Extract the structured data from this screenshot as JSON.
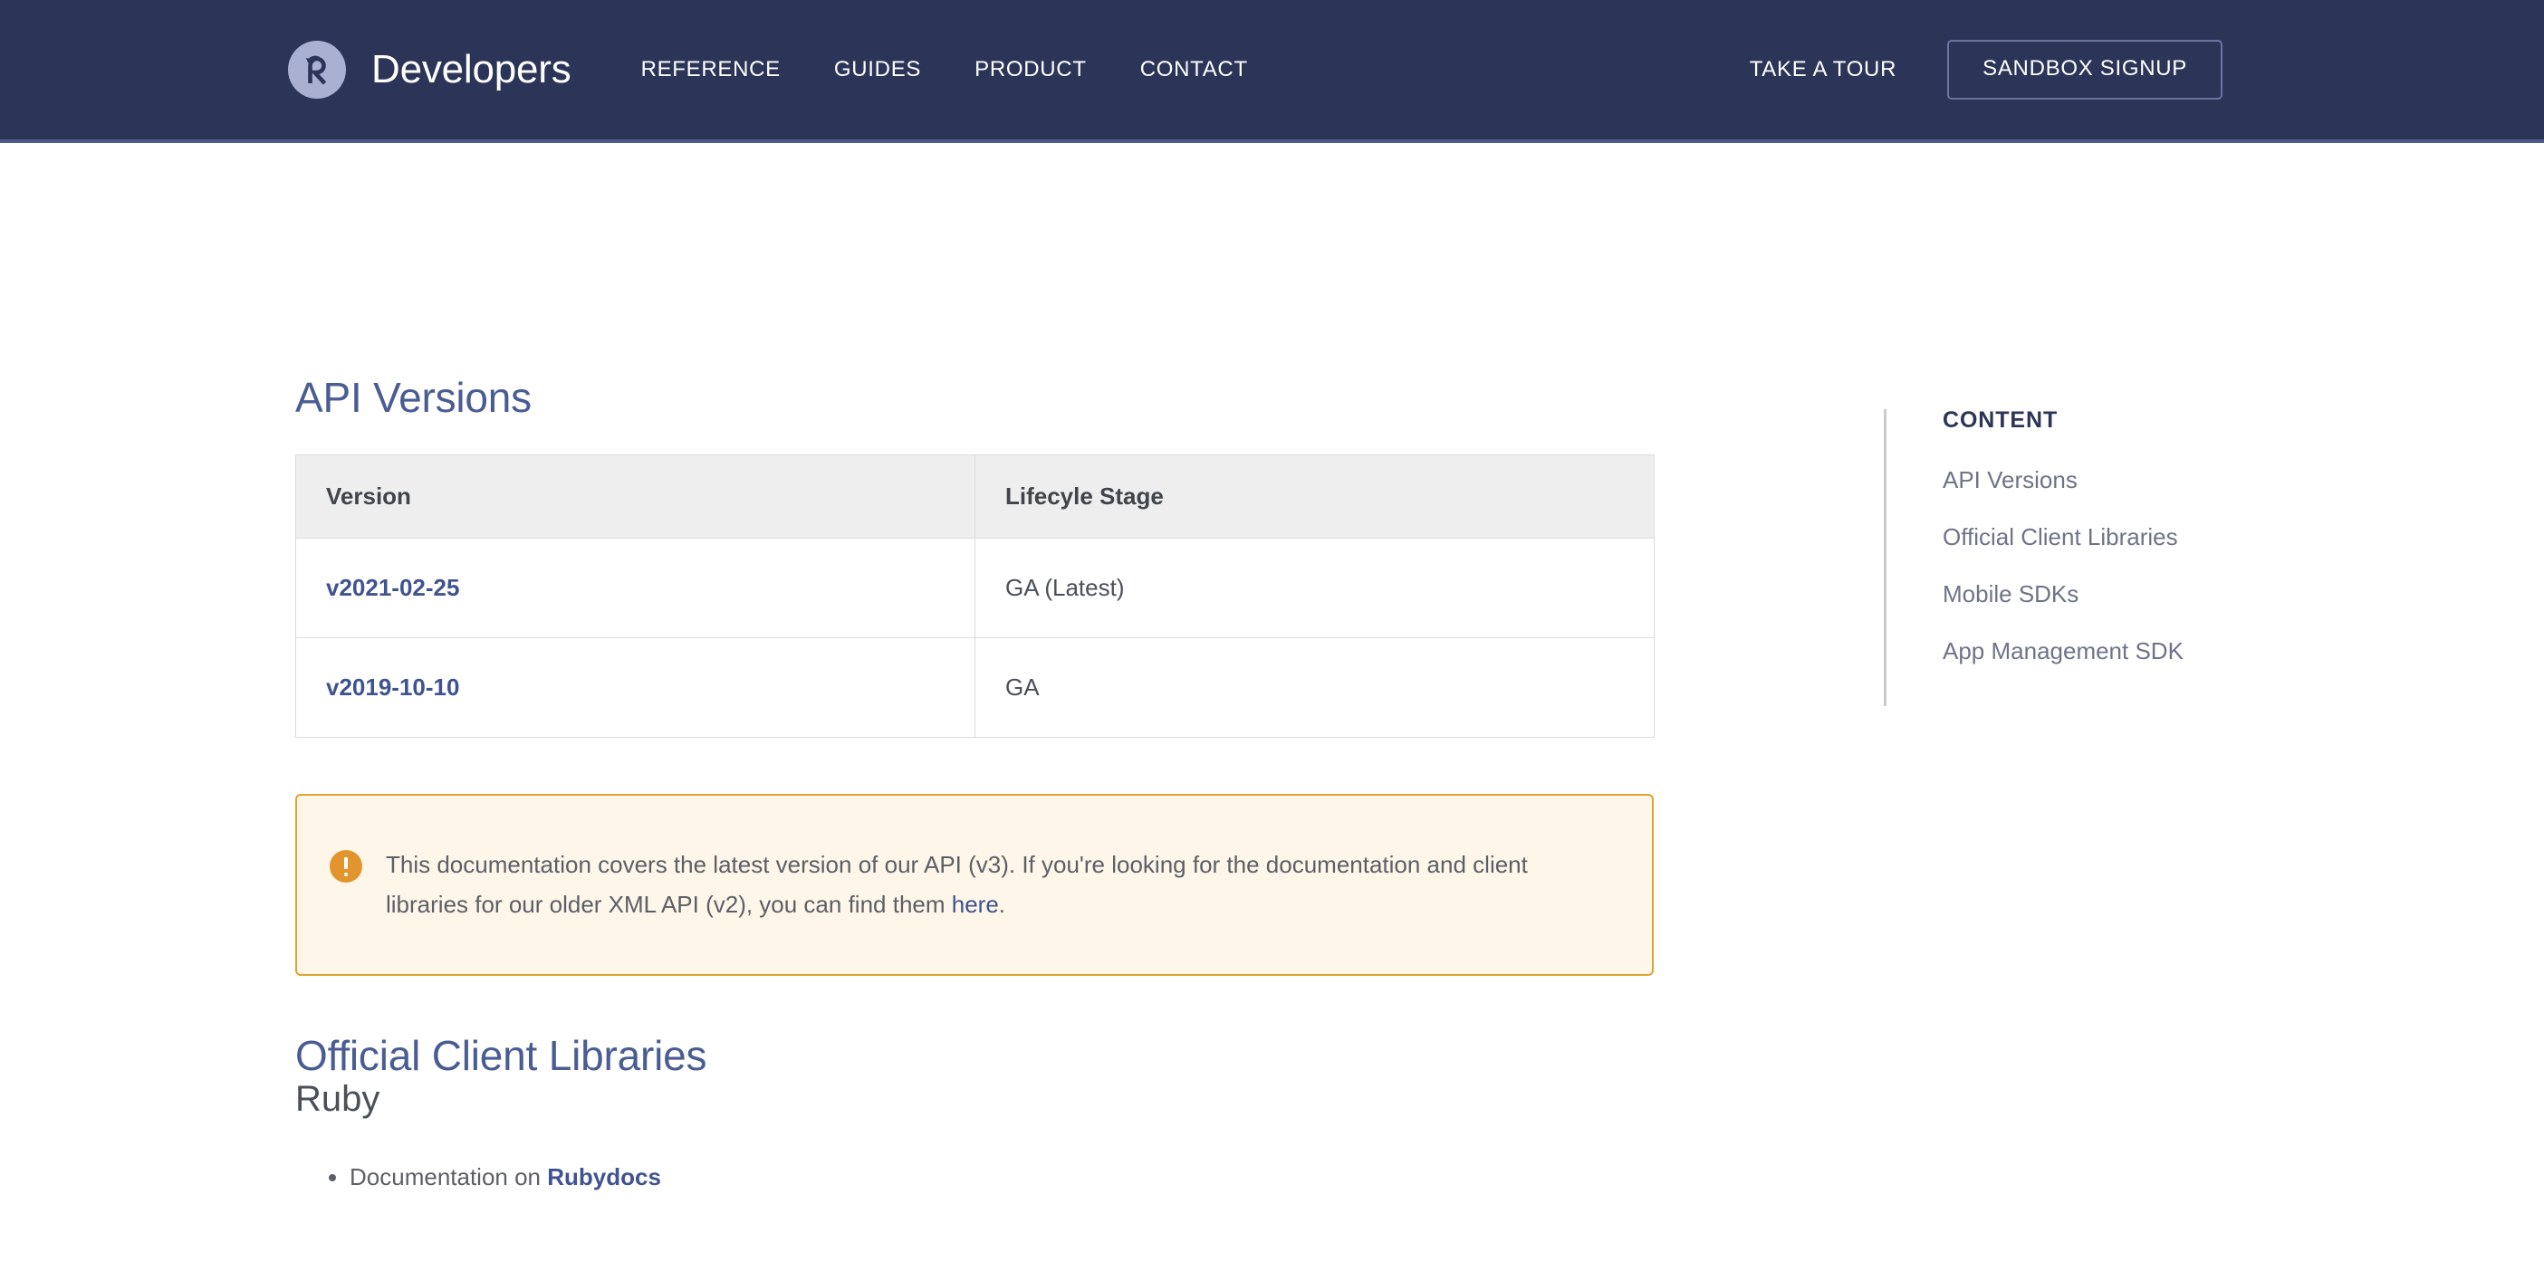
{
  "header": {
    "logo_icon": "recurly-r-logo-icon",
    "brand": "Developers",
    "nav": [
      {
        "label": "REFERENCE"
      },
      {
        "label": "GUIDES"
      },
      {
        "label": "PRODUCT"
      },
      {
        "label": "CONTACT"
      }
    ],
    "tour_label": "TAKE A TOUR",
    "signup_label": "SANDBOX SIGNUP",
    "background_color": "#2c3458",
    "accent_border_color": "#4d5a8a",
    "logo_bg_color": "#a9b0d2"
  },
  "main": {
    "api_versions": {
      "heading": "API Versions",
      "table": {
        "columns": [
          "Version",
          "Lifecyle Stage"
        ],
        "rows": [
          {
            "version": "v2021-02-25",
            "stage": "GA (Latest)"
          },
          {
            "version": "v2019-10-10",
            "stage": "GA"
          }
        ]
      }
    },
    "callout": {
      "icon": "warning-exclamation-icon",
      "text_before_link": "This documentation covers the latest version of our API (v3). If you're looking for the documentation and client libraries for our older XML API (v2), you can find them ",
      "link_label": "here",
      "text_after_link": ".",
      "border_color": "#e0a32e",
      "background_color": "#fdf6e9",
      "icon_color": "#e2952c"
    },
    "client_libraries": {
      "heading": "Official Client Libraries",
      "subheading": "Ruby",
      "items": [
        {
          "text_before_link": "Documentation on ",
          "link_label": "Rubydocs"
        }
      ]
    }
  },
  "toc": {
    "title": "CONTENT",
    "items": [
      {
        "label": "API Versions"
      },
      {
        "label": "Official Client Libraries"
      },
      {
        "label": "Mobile SDKs"
      },
      {
        "label": "App Management SDK"
      }
    ]
  },
  "colors": {
    "heading_blue": "#4a5d93",
    "link_blue": "#3f5390",
    "body_gray": "#5c5f66",
    "table_header_bg": "#eeeeee",
    "table_border": "#dcdcdc"
  }
}
